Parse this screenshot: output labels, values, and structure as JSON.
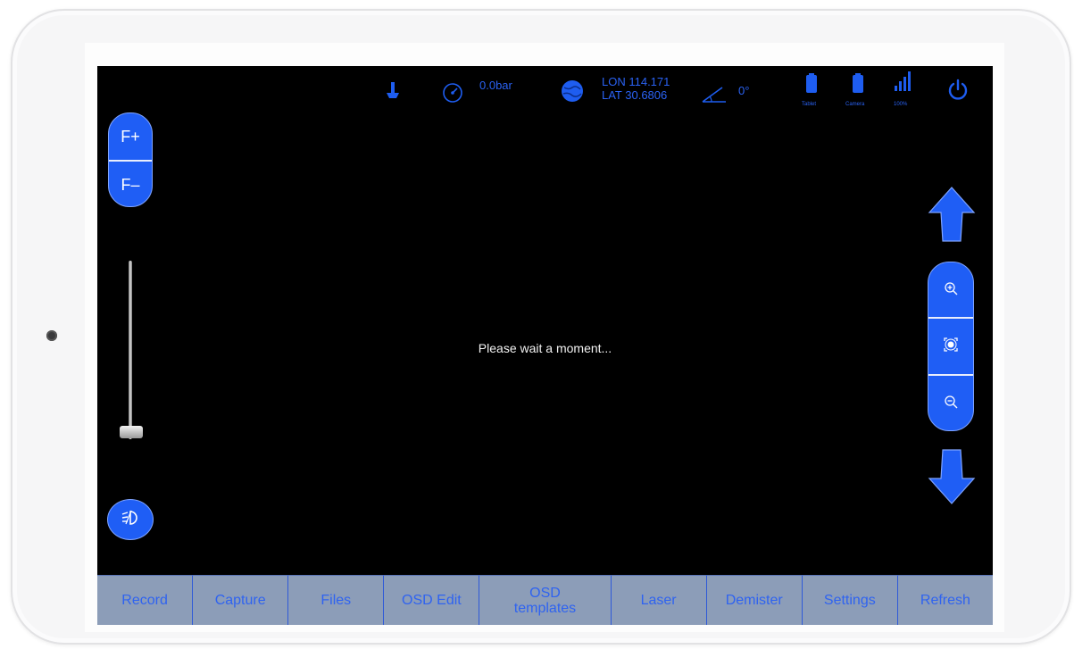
{
  "status": {
    "pressure": "0.0bar",
    "lon": "LON 114.171",
    "lat": "LAT 30.6806",
    "angle": "0°",
    "tablet_label": "Tablet",
    "camera_label": "Camera",
    "signal_label": "100%"
  },
  "left": {
    "focus_plus": "F+",
    "focus_minus": "F–",
    "light_level": 0.05
  },
  "main": {
    "message": "Please wait a moment..."
  },
  "bottom_tabs": [
    "Record",
    "Capture",
    "Files",
    "OSD Edit",
    "OSD templates",
    "Laser",
    "Demister",
    "Settings",
    "Refresh"
  ],
  "colors": {
    "accent": "#1f5ef5",
    "background": "#000000",
    "bottom_bar": "#8c9db8",
    "status_icons": "#1e5df0"
  },
  "icons": [
    "probe-icon",
    "pressure-gauge-icon",
    "globe-icon",
    "angle-icon",
    "tablet-battery-icon",
    "camera-battery-icon",
    "signal-icon",
    "power-icon",
    "light-icon",
    "zoom-in-icon",
    "auto-focus-icon",
    "zoom-out-icon",
    "arrow-up-icon",
    "arrow-down-icon"
  ]
}
